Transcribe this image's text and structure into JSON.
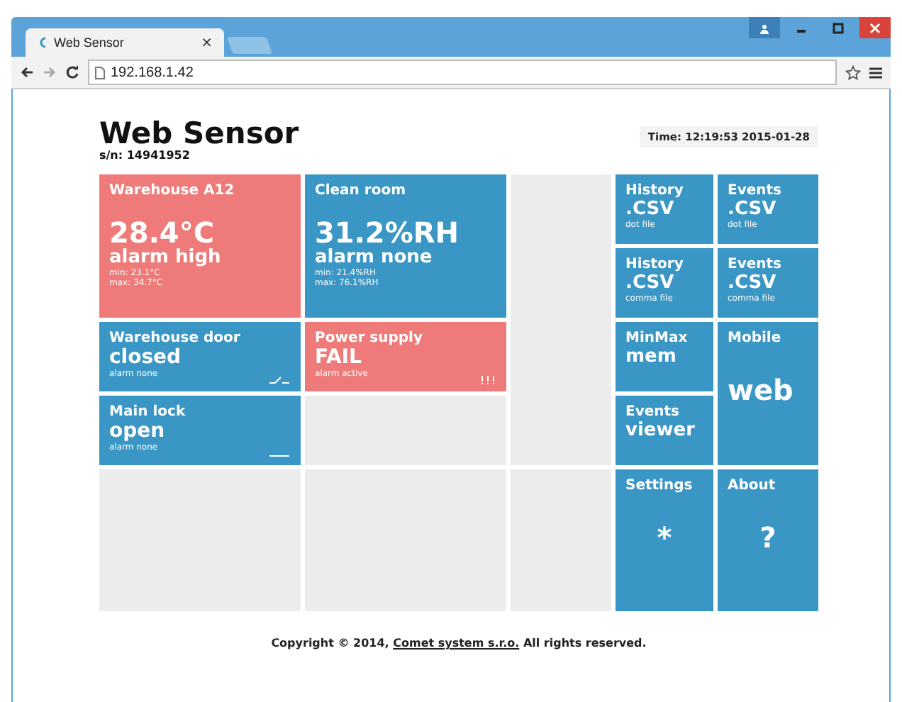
{
  "browser": {
    "tab_title": "Web Sensor",
    "tab_close": "×",
    "address": "192.168.1.42"
  },
  "header": {
    "title": "Web Sensor",
    "serial": "s/n: 14941952",
    "time": "Time: 12:19:53 2015-01-28"
  },
  "sensors": [
    {
      "kind": "analog",
      "name": "Warehouse A12",
      "alarm": true,
      "value": "28.4°C",
      "status": "alarm high",
      "min": "min: 23.1°C",
      "max": "max: 34.7°C"
    },
    {
      "kind": "analog",
      "name": "Clean room",
      "alarm": false,
      "value": "31.2%RH",
      "status": "alarm none",
      "min": "min: 21.4%RH",
      "max": "max: 76.1%RH"
    },
    {
      "kind": "binary",
      "name": "Warehouse door",
      "alarm": false,
      "value": "closed",
      "status": "alarm none"
    },
    {
      "kind": "binary",
      "name": "Power supply",
      "alarm": true,
      "value": "FAIL",
      "status": "alarm active"
    },
    {
      "kind": "binary",
      "name": "Main lock",
      "alarm": false,
      "value": "open",
      "status": "alarm none"
    }
  ],
  "links": [
    {
      "kind": "file",
      "title": "History",
      "main": ".CSV",
      "sub": "dot file"
    },
    {
      "kind": "file",
      "title": "Events",
      "main": ".CSV",
      "sub": "dot file"
    },
    {
      "kind": "file",
      "title": "History",
      "main": ".CSV",
      "sub": "comma file"
    },
    {
      "kind": "file",
      "title": "Events",
      "main": ".CSV",
      "sub": "comma file"
    },
    {
      "kind": "short",
      "title": "MinMax",
      "main": "mem"
    },
    {
      "kind": "large",
      "title": "Mobile",
      "main": "web"
    },
    {
      "kind": "short",
      "title": "Events",
      "main": "viewer"
    },
    {
      "kind": "symbol",
      "title": "Settings",
      "main": "*"
    },
    {
      "kind": "symbol",
      "title": "About",
      "main": "?"
    }
  ],
  "footer": {
    "text": "Copyright © 2014,",
    "link": "Comet system s.r.o.",
    "rest": "All rights reserved."
  }
}
